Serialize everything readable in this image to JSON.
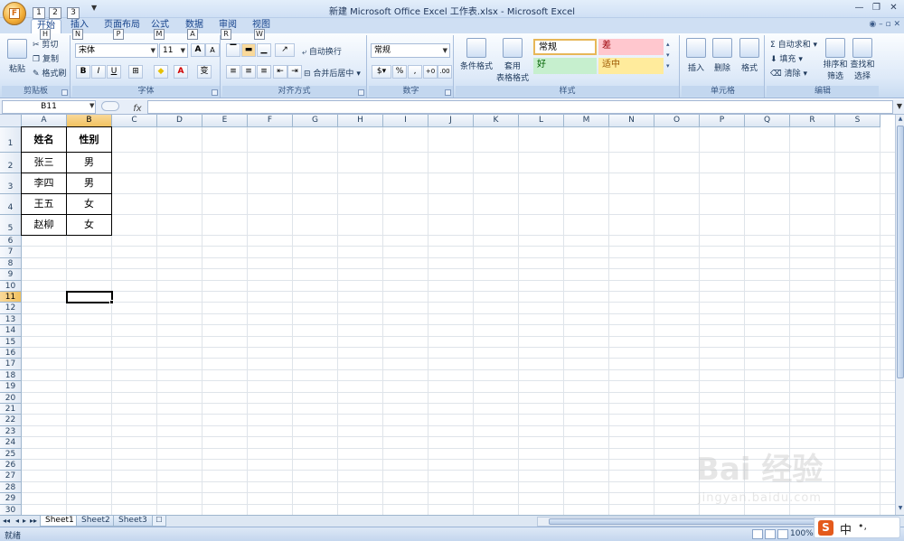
{
  "window": {
    "title": "新建 Microsoft Office Excel 工作表.xlsx - Microsoft Excel",
    "office_button": "F",
    "qat_keys": [
      "1",
      "2",
      "3"
    ],
    "controls": {
      "minimize": "—",
      "restore": "❐",
      "close": "✕"
    }
  },
  "tabs": [
    {
      "label": "开始",
      "key": "H",
      "active": true
    },
    {
      "label": "插入",
      "key": "N"
    },
    {
      "label": "页面布局",
      "key": "P"
    },
    {
      "label": "公式",
      "key": "M"
    },
    {
      "label": "数据",
      "key": "A"
    },
    {
      "label": "审阅",
      "key": "R"
    },
    {
      "label": "视图",
      "key": "W"
    }
  ],
  "help_icons": "◉ – ▫ ✕",
  "ribbon": {
    "clipboard": {
      "label": "剪贴板",
      "paste": "粘贴",
      "cut": "剪切",
      "copy": "复制",
      "format_painter": "格式刷"
    },
    "font": {
      "label": "字体",
      "font_name": "宋体",
      "font_size": "11",
      "grow": "A",
      "shrink": "A",
      "bold": "B",
      "italic": "I",
      "underline": "U",
      "border": "⊞",
      "fill": "◆",
      "font_color": "A",
      "phonetic": "变"
    },
    "alignment": {
      "label": "对齐方式",
      "wrap_text": "自动换行",
      "merge_center": "合并后居中"
    },
    "number": {
      "label": "数字",
      "format": "常规",
      "percent": "%",
      "comma": ",",
      "inc_decimal": "+0",
      "dec_decimal": ".00"
    },
    "styles": {
      "label": "样式",
      "conditional": "条件格式",
      "table_format_1": "套用",
      "table_format_2": "表格格式",
      "normal": "常规",
      "bad": "差",
      "good": "好",
      "neutral": "适中",
      "colors": {
        "normal": "#ffffff",
        "bad": "#ffc7ce",
        "good": "#c6efce",
        "neutral": "#ffeb9c",
        "bad_text": "#9c0006",
        "good_text": "#006100",
        "neutral_text": "#9c5700"
      }
    },
    "cells": {
      "label": "单元格",
      "insert": "插入",
      "delete": "删除",
      "format": "格式"
    },
    "editing": {
      "label": "编辑",
      "autosum": "自动求和",
      "fill": "填充",
      "clear": "清除",
      "sort_filter_1": "排序和",
      "sort_filter_2": "筛选",
      "find_select_1": "查找和",
      "find_select_2": "选择"
    }
  },
  "formula_bar": {
    "name_box": "B11",
    "fx": "fx",
    "value": ""
  },
  "columns": [
    "A",
    "B",
    "C",
    "D",
    "E",
    "F",
    "G",
    "H",
    "I",
    "J",
    "K",
    "L",
    "M",
    "N",
    "O",
    "P",
    "Q",
    "R",
    "S"
  ],
  "rows": [
    "1",
    "2",
    "3",
    "4",
    "5",
    "6",
    "7",
    "8",
    "9",
    "10",
    "11",
    "12",
    "13",
    "14",
    "15",
    "16",
    "17",
    "18",
    "19",
    "20",
    "21",
    "22",
    "23",
    "24",
    "25",
    "26",
    "27",
    "28",
    "29",
    "30"
  ],
  "selected": {
    "column": "B",
    "row": "11"
  },
  "table": {
    "header": [
      "姓名",
      "性别"
    ],
    "rows": [
      [
        "张三",
        "男"
      ],
      [
        "李四",
        "男"
      ],
      [
        "王五",
        "女"
      ],
      [
        "赵柳",
        "女"
      ]
    ]
  },
  "sheets": [
    {
      "name": "Sheet1",
      "active": true
    },
    {
      "name": "Sheet2"
    },
    {
      "name": "Sheet3"
    }
  ],
  "sheet_nav": [
    "◂◂",
    "◂",
    "▸",
    "▸▸"
  ],
  "status": {
    "ready": "就绪",
    "zoom": "100%",
    "zoom_minus": "⊖"
  },
  "ime": {
    "logo": "S",
    "mode": "中",
    "punct": "•,"
  },
  "watermark": {
    "logo": "Bai 经验",
    "url": "jingyan.baidu.com"
  }
}
